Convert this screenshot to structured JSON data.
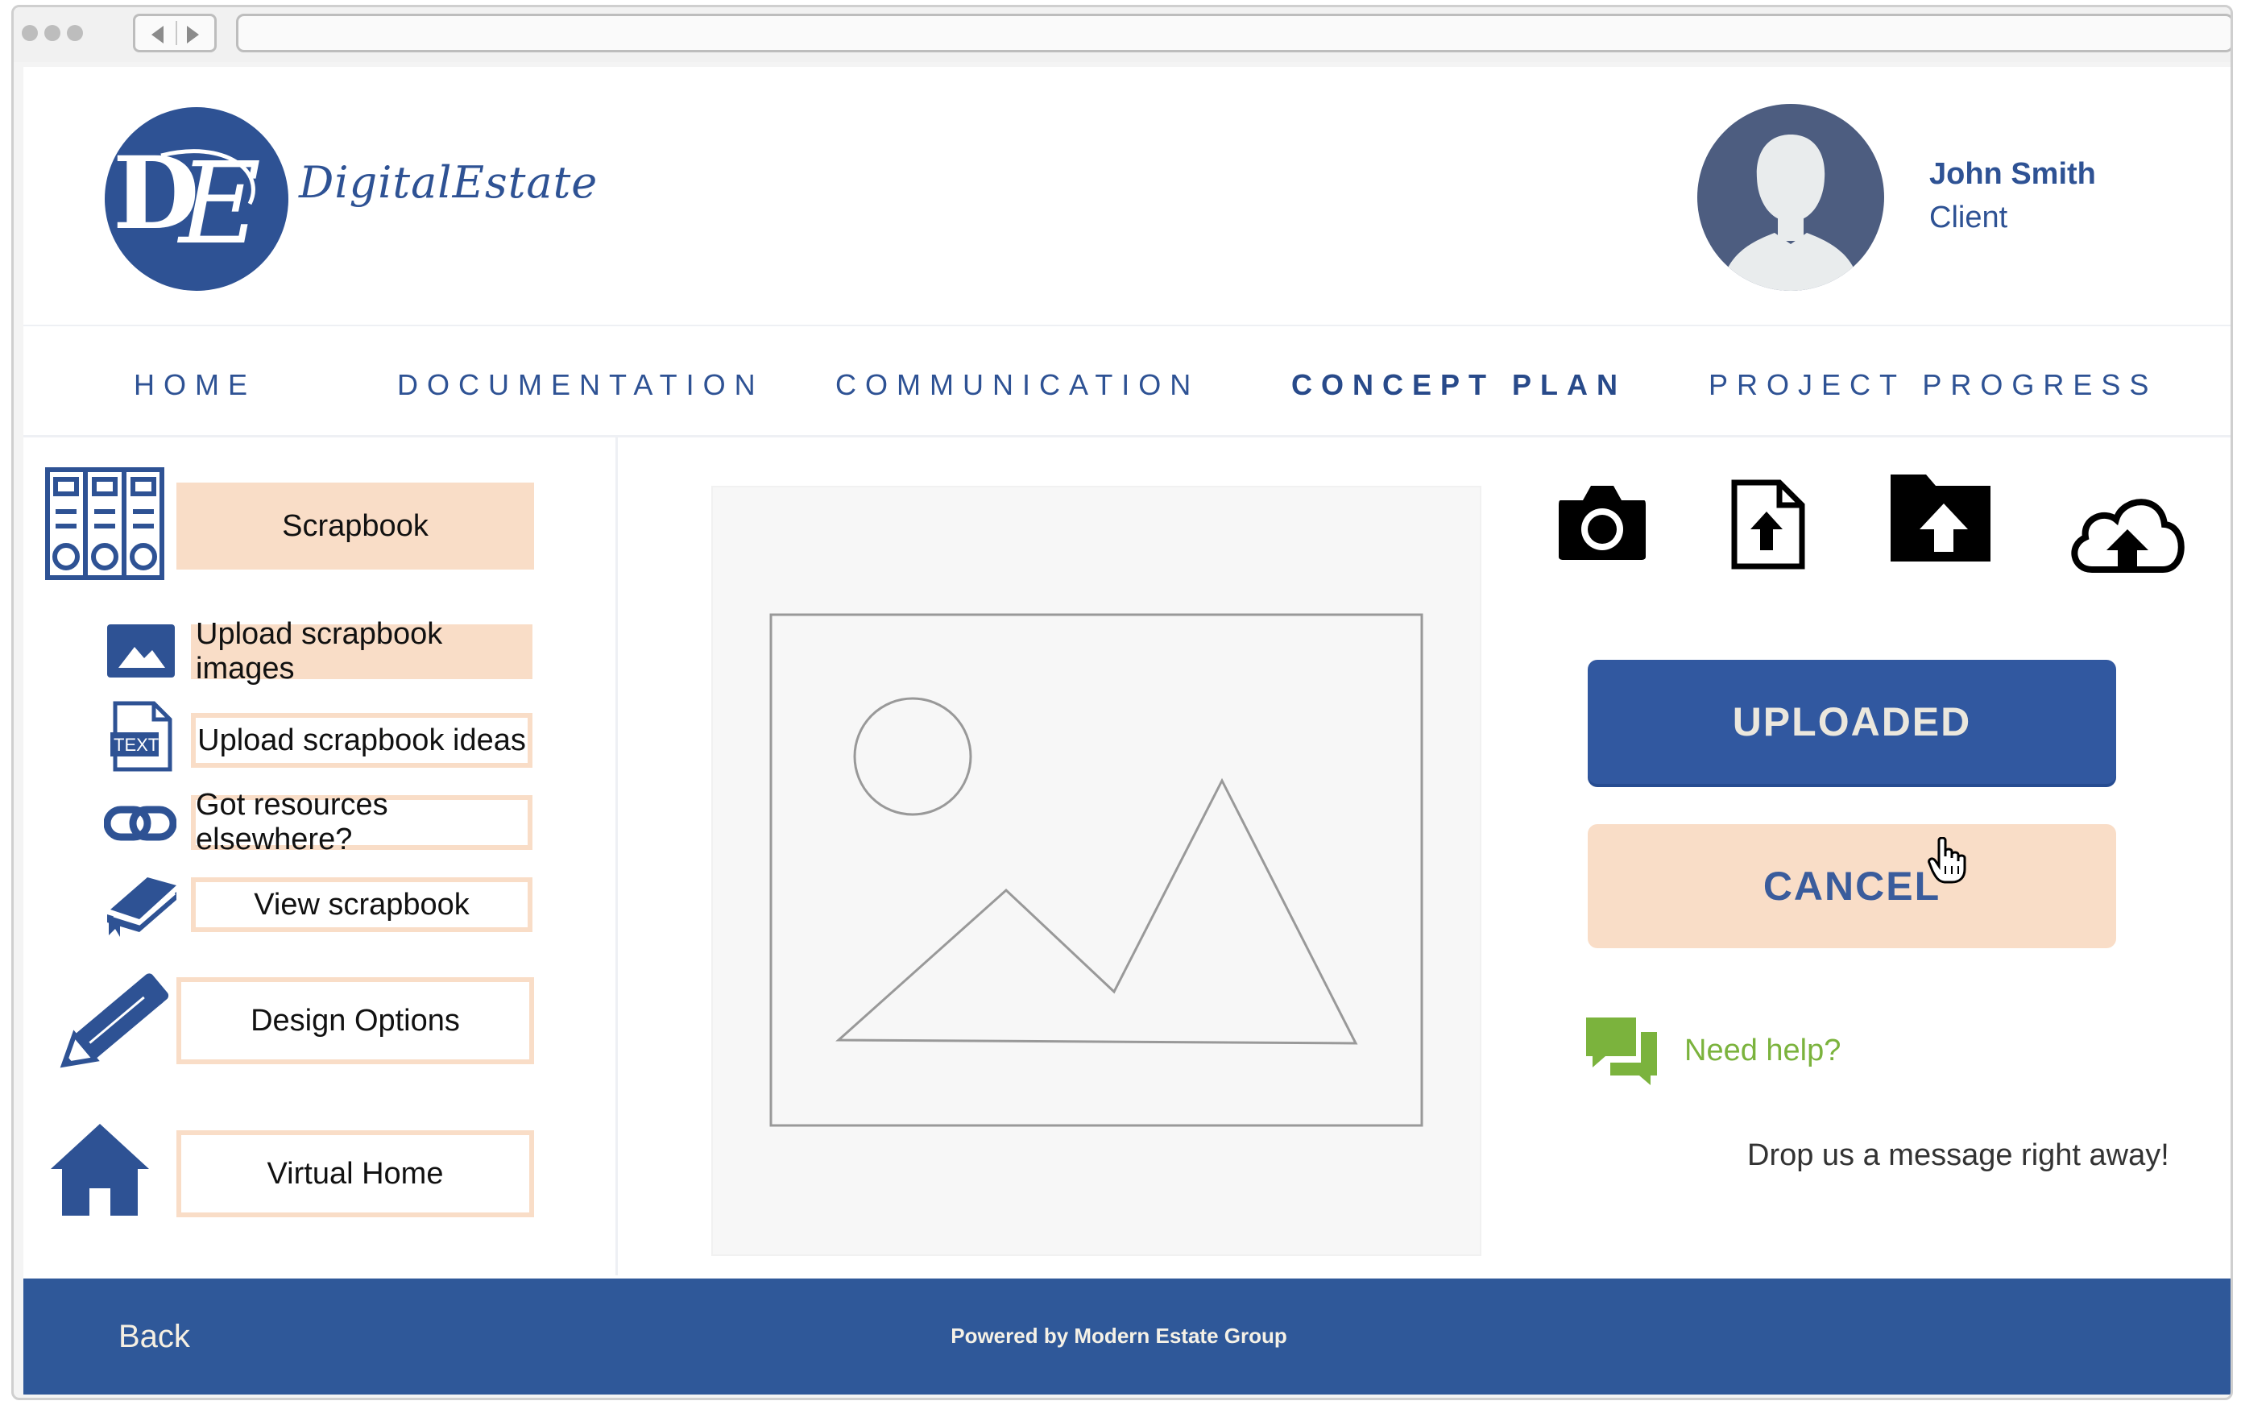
{
  "brand": {
    "name": "DigitalEstate",
    "logo_mark": "DE"
  },
  "user": {
    "name": "John Smith",
    "role": "Client"
  },
  "nav": {
    "items": [
      {
        "label": "HOME",
        "active": false
      },
      {
        "label": "DOCUMENTATION",
        "active": false
      },
      {
        "label": "COMMUNICATION",
        "active": false
      },
      {
        "label": "CONCEPT PLAN",
        "active": true
      },
      {
        "label": "PROJECT PROGRESS",
        "active": false
      }
    ]
  },
  "sidebar": {
    "scrapbook": {
      "label": "Scrapbook",
      "icon": "binders-icon"
    },
    "sub_items": [
      {
        "label": "Upload scrapbook images",
        "icon": "image-icon",
        "active": true
      },
      {
        "label": "Upload scrapbook ideas",
        "icon": "text-file-icon"
      },
      {
        "label": "Got resources elsewhere?",
        "icon": "link-icon"
      },
      {
        "label": "View scrapbook",
        "icon": "book-icon"
      }
    ],
    "design_options": {
      "label": "Design Options",
      "icon": "pencil-icon"
    },
    "virtual_home": {
      "label": "Virtual Home",
      "icon": "home-icon"
    }
  },
  "tools": [
    {
      "icon": "camera-icon"
    },
    {
      "icon": "file-upload-icon"
    },
    {
      "icon": "folder-upload-icon"
    },
    {
      "icon": "cloud-upload-icon"
    }
  ],
  "actions": {
    "uploaded_label": "UPLOADED",
    "cancel_label": "CANCEL"
  },
  "help": {
    "link_label": "Need help?",
    "message": "Drop us a message right away!",
    "icon": "chat-icon"
  },
  "footer": {
    "back_label": "Back",
    "credit": "Powered by Modern Estate Group"
  },
  "colors": {
    "brand_blue": "#2e5294",
    "peach": "#f9ddc7",
    "help_green": "#7bb33d",
    "footer_blue": "#2f5899"
  }
}
